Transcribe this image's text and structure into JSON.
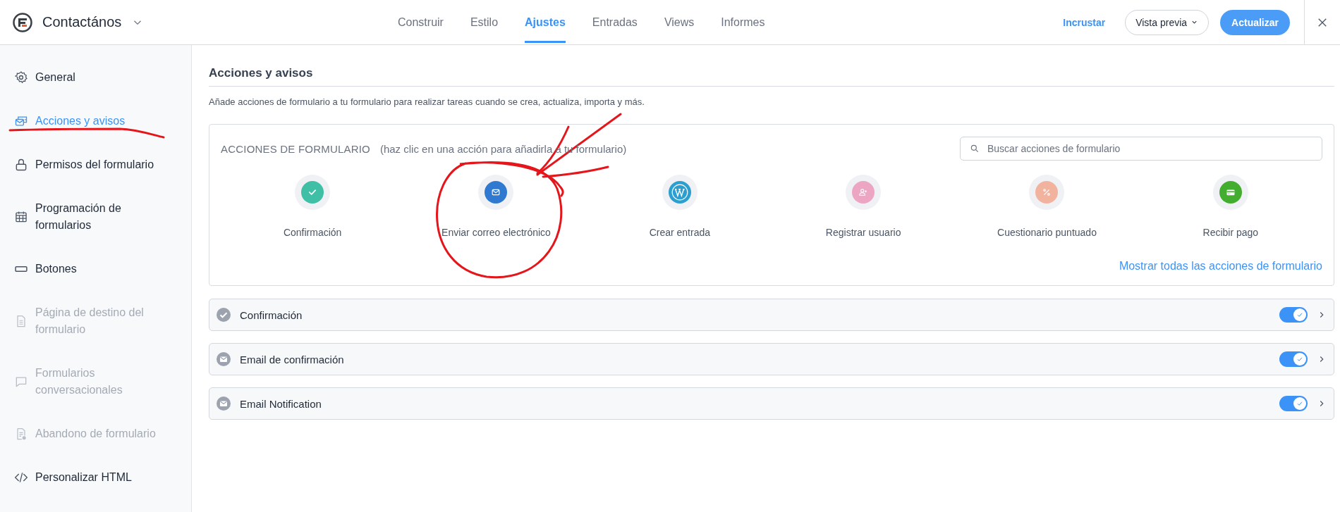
{
  "header": {
    "form_title": "Contactános",
    "tabs": [
      {
        "label": "Construir",
        "selected": false
      },
      {
        "label": "Estilo",
        "selected": false
      },
      {
        "label": "Ajustes",
        "selected": true
      },
      {
        "label": "Entradas",
        "selected": false
      },
      {
        "label": "Views",
        "selected": false
      },
      {
        "label": "Informes",
        "selected": false
      }
    ],
    "embed_link": "Incrustar",
    "preview_button": "Vista previa",
    "update_button": "Actualizar"
  },
  "sidebar": {
    "items": [
      {
        "label": "General",
        "selected": false,
        "disabled": false
      },
      {
        "label": "Acciones y avisos",
        "selected": true,
        "disabled": false
      },
      {
        "label": "Permisos del formulario",
        "selected": false,
        "disabled": false
      },
      {
        "label": "Programación de formularios",
        "selected": false,
        "disabled": false
      },
      {
        "label": "Botones",
        "selected": false,
        "disabled": false
      },
      {
        "label": "Página de destino del formulario",
        "selected": false,
        "disabled": true
      },
      {
        "label": "Formularios conversacionales",
        "selected": false,
        "disabled": true
      },
      {
        "label": "Abandono de formulario",
        "selected": false,
        "disabled": true
      },
      {
        "label": "Personalizar HTML",
        "selected": false,
        "disabled": false
      }
    ]
  },
  "section": {
    "title": "Acciones y avisos",
    "description": "Añade acciones de formulario a tu formulario para realizar tareas cuando se crea, actualiza, importa y más.",
    "panel": {
      "heading": "ACCIONES DE FORMULARIO",
      "hint": "(haz clic en una acción para añadirla a tu formulario)",
      "search": {
        "placeholder": "Buscar acciones de formulario"
      },
      "actions": [
        {
          "label": "Confirmación",
          "color": "#3ebfa6"
        },
        {
          "label": "Enviar correo electrónico",
          "color": "#2f7ad0"
        },
        {
          "label": "Crear entrada",
          "color": "#2a9fd0"
        },
        {
          "label": "Registrar usuario",
          "color": "#eca6c4"
        },
        {
          "label": "Cuestionario puntuado",
          "color": "#f2b39e"
        },
        {
          "label": "Recibir pago",
          "color": "#43ad2f"
        }
      ],
      "show_all_link": "Mostrar todas las acciones de formulario"
    },
    "rows": [
      {
        "title": "Confirmación",
        "on": true
      },
      {
        "title": "Email de confirmación",
        "on": true
      },
      {
        "title": "Email Notification",
        "on": true
      }
    ]
  }
}
